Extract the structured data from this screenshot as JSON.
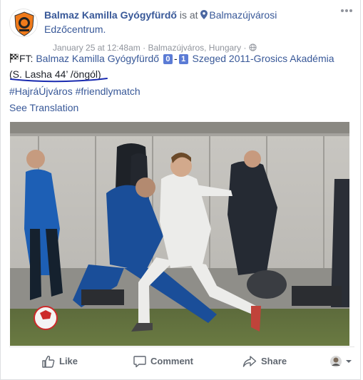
{
  "post": {
    "page_name": "Balmaz Kamilla Gyógyfürdő",
    "is_at": "is at",
    "place": "Balmazújvárosi Edzőcentrum.",
    "date": "January 25 at 12:48am",
    "sep1": "·",
    "location": "Balmazújváros, Hungary",
    "sep2": "·",
    "text": {
      "prefix": "FT:",
      "home_team": "Balmaz Kamilla Gyógyfürdő",
      "home_score": "0",
      "dash": "-",
      "away_score": "1",
      "away_team": "Szeged 2011-Grosics Akadémia",
      "scorer": "(S. Lasha 44’ /öngól)",
      "hashtag1": "#HajráÚjváros",
      "hashtag2": "#friendlymatch"
    },
    "see_translation": "See Translation"
  },
  "actions": {
    "like": "Like",
    "comment": "Comment",
    "share": "Share"
  },
  "icons": {
    "menu": "more-options-icon",
    "pin": "location-pin-icon",
    "globe": "privacy-globe-icon",
    "flag": "chequered-flag-emoji",
    "like": "thumbs-up-icon",
    "comment": "speech-bubble-icon",
    "share": "share-arrow-icon",
    "viewer": "viewer-avatar-dropdown"
  },
  "colors": {
    "link": "#385898",
    "score_badge": "#5b7bd5",
    "annotation": "#1a2bb0"
  }
}
